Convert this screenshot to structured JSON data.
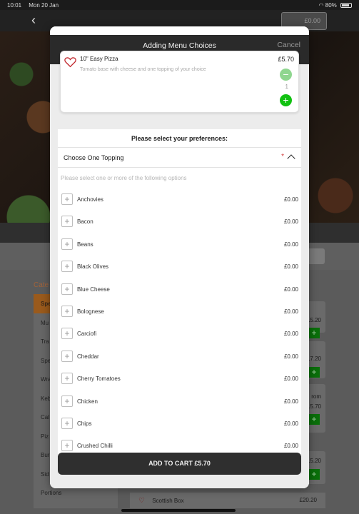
{
  "status_bar": {
    "time": "10:01",
    "date": "Mon 20 Jan",
    "battery": "80%"
  },
  "header": {
    "back_icon": "chevron-left-icon",
    "cart_total": "£0.00"
  },
  "background": {
    "categories_title": "Cate",
    "categories": [
      "Spe",
      "Mu",
      "Tra",
      "Spe",
      "Wra",
      "Keb",
      "Cal",
      "Piz",
      "Bur",
      "Sid",
      "Portions"
    ],
    "prices": [
      ".5.20",
      ".7.20",
      "rom",
      ".5.70",
      ".5.20"
    ],
    "bottom_item": {
      "name": "Scottish Box",
      "price": "£20.20"
    }
  },
  "modal": {
    "title": "Adding Menu Choices",
    "cancel_label": "Cancel",
    "item": {
      "name": "10\" Easy Pizza",
      "description": "Tomato base with cheese and one topping of your choice",
      "price": "£5.70",
      "quantity": "1"
    },
    "preferences_heading": "Please select your preferences:",
    "group": {
      "title": "Choose One Topping",
      "required_mark": "*",
      "hint": "Please select one or more of the following options",
      "options": [
        {
          "label": "Anchovies",
          "price": "£0.00"
        },
        {
          "label": "Bacon",
          "price": "£0.00"
        },
        {
          "label": "Beans",
          "price": "£0.00"
        },
        {
          "label": "Black Olives",
          "price": "£0.00"
        },
        {
          "label": "Blue Cheese",
          "price": "£0.00"
        },
        {
          "label": "Bolognese",
          "price": "£0.00"
        },
        {
          "label": "Carciofi",
          "price": "£0.00"
        },
        {
          "label": "Cheddar",
          "price": "£0.00"
        },
        {
          "label": "Cherry Tomatoes",
          "price": "£0.00"
        },
        {
          "label": "Chicken",
          "price": "£0.00"
        },
        {
          "label": "Chips",
          "price": "£0.00"
        },
        {
          "label": "Crushed Chilli",
          "price": "£0.00"
        }
      ]
    },
    "add_to_cart_label": "ADD TO CART £5.70"
  },
  "colors": {
    "accent_green": "#11c111",
    "dark": "#2a2a2a",
    "required_red": "#d23b3b"
  }
}
